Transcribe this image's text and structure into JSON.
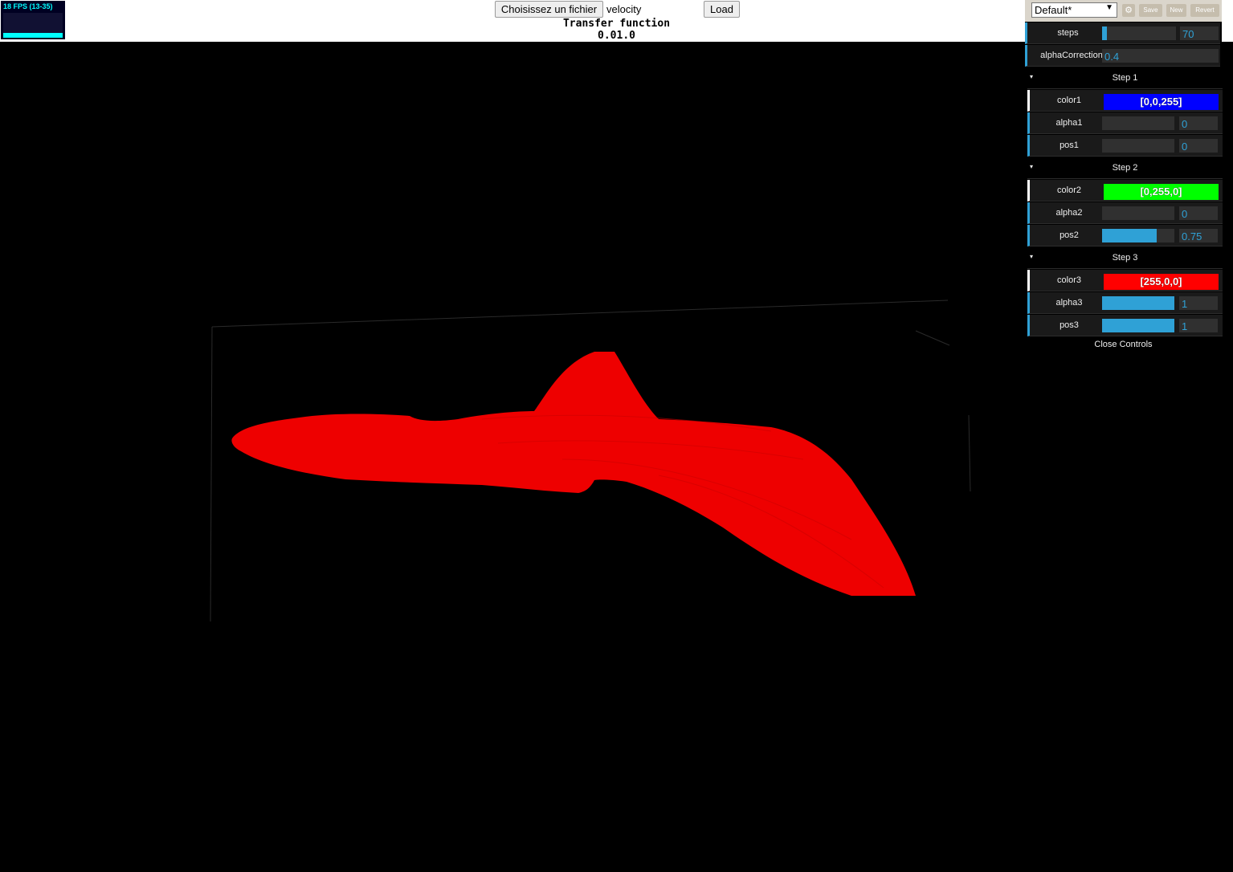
{
  "toolbar": {
    "file_button_label": "Choisissez un fichier",
    "file_name": "velocity",
    "load_button_label": "Load"
  },
  "header": {
    "title": "Transfer function",
    "version": "0.01.0"
  },
  "stats": {
    "fps_text": "18 FPS (13-35)"
  },
  "gui": {
    "preset": "Default*",
    "save_label": "Save",
    "new_label": "New",
    "revert_label": "Revert",
    "steps": {
      "label": "steps",
      "value": "70",
      "fraction": 0.07
    },
    "alphaCorrection": {
      "label": "alphaCorrection",
      "value": "0.4"
    },
    "folders": [
      {
        "title": "Step 1",
        "color": {
          "label": "color1",
          "value": "[0,0,255]",
          "hex": "#0000ff"
        },
        "alpha": {
          "label": "alpha1",
          "value": "0",
          "fraction": 0
        },
        "pos": {
          "label": "pos1",
          "value": "0",
          "fraction": 0
        }
      },
      {
        "title": "Step 2",
        "color": {
          "label": "color2",
          "value": "[0,255,0]",
          "hex": "#00ff00"
        },
        "alpha": {
          "label": "alpha2",
          "value": "0",
          "fraction": 0
        },
        "pos": {
          "label": "pos2",
          "value": "0.75",
          "fraction": 0.75
        }
      },
      {
        "title": "Step 3",
        "color": {
          "label": "color3",
          "value": "[255,0,0]",
          "hex": "#ff0000"
        },
        "alpha": {
          "label": "alpha3",
          "value": "1",
          "fraction": 1
        },
        "pos": {
          "label": "pos3",
          "value": "1",
          "fraction": 1
        }
      }
    ],
    "close_label": "Close Controls"
  },
  "colors": {
    "accent": "#2fa1d6",
    "volume": "#ff0000",
    "background": "#000000"
  }
}
